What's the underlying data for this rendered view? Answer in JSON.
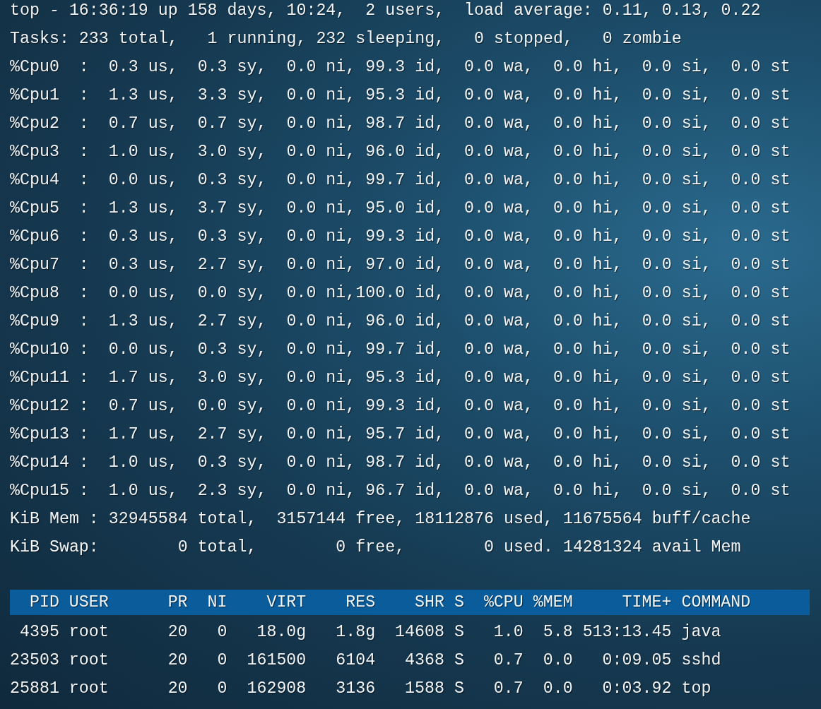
{
  "summary_lines": [
    "top - 16:36:19 up 158 days, 10:24,  2 users,  load average: 0.11, 0.13, 0.22",
    "Tasks: 233 total,   1 running, 232 sleeping,   0 stopped,   0 zombie",
    "%Cpu0  :  0.3 us,  0.3 sy,  0.0 ni, 99.3 id,  0.0 wa,  0.0 hi,  0.0 si,  0.0 st",
    "%Cpu1  :  1.3 us,  3.3 sy,  0.0 ni, 95.3 id,  0.0 wa,  0.0 hi,  0.0 si,  0.0 st",
    "%Cpu2  :  0.7 us,  0.7 sy,  0.0 ni, 98.7 id,  0.0 wa,  0.0 hi,  0.0 si,  0.0 st",
    "%Cpu3  :  1.0 us,  3.0 sy,  0.0 ni, 96.0 id,  0.0 wa,  0.0 hi,  0.0 si,  0.0 st",
    "%Cpu4  :  0.0 us,  0.3 sy,  0.0 ni, 99.7 id,  0.0 wa,  0.0 hi,  0.0 si,  0.0 st",
    "%Cpu5  :  1.3 us,  3.7 sy,  0.0 ni, 95.0 id,  0.0 wa,  0.0 hi,  0.0 si,  0.0 st",
    "%Cpu6  :  0.3 us,  0.3 sy,  0.0 ni, 99.3 id,  0.0 wa,  0.0 hi,  0.0 si,  0.0 st",
    "%Cpu7  :  0.3 us,  2.7 sy,  0.0 ni, 97.0 id,  0.0 wa,  0.0 hi,  0.0 si,  0.0 st",
    "%Cpu8  :  0.0 us,  0.0 sy,  0.0 ni,100.0 id,  0.0 wa,  0.0 hi,  0.0 si,  0.0 st",
    "%Cpu9  :  1.3 us,  2.7 sy,  0.0 ni, 96.0 id,  0.0 wa,  0.0 hi,  0.0 si,  0.0 st",
    "%Cpu10 :  0.0 us,  0.3 sy,  0.0 ni, 99.7 id,  0.0 wa,  0.0 hi,  0.0 si,  0.0 st",
    "%Cpu11 :  1.7 us,  3.0 sy,  0.0 ni, 95.3 id,  0.0 wa,  0.0 hi,  0.0 si,  0.0 st",
    "%Cpu12 :  0.7 us,  0.0 sy,  0.0 ni, 99.3 id,  0.0 wa,  0.0 hi,  0.0 si,  0.0 st",
    "%Cpu13 :  1.7 us,  2.7 sy,  0.0 ni, 95.7 id,  0.0 wa,  0.0 hi,  0.0 si,  0.0 st",
    "%Cpu14 :  1.0 us,  0.3 sy,  0.0 ni, 98.7 id,  0.0 wa,  0.0 hi,  0.0 si,  0.0 st",
    "%Cpu15 :  1.0 us,  2.3 sy,  0.0 ni, 96.7 id,  0.0 wa,  0.0 hi,  0.0 si,  0.0 st",
    "KiB Mem : 32945584 total,  3157144 free, 18112876 used, 11675564 buff/cache",
    "KiB Swap:        0 total,        0 free,        0 used. 14281324 avail Mem"
  ],
  "process_table": {
    "columns": [
      "PID",
      "USER",
      "PR",
      "NI",
      "VIRT",
      "RES",
      "SHR",
      "S",
      "%CPU",
      "%MEM",
      "TIME+",
      "COMMAND"
    ],
    "rows": [
      [
        "4395",
        "root",
        "20",
        "0",
        "18.0g",
        "1.8g",
        "14608",
        "S",
        "1.0",
        "5.8",
        "513:13.45",
        "java"
      ],
      [
        "23503",
        "root",
        "20",
        "0",
        "161500",
        "6104",
        "4368",
        "S",
        "0.7",
        "0.0",
        "0:09.05",
        "sshd"
      ],
      [
        "25881",
        "root",
        "20",
        "0",
        "162908",
        "3136",
        "1588",
        "S",
        "0.7",
        "0.0",
        "0:03.92",
        "top"
      ]
    ]
  }
}
